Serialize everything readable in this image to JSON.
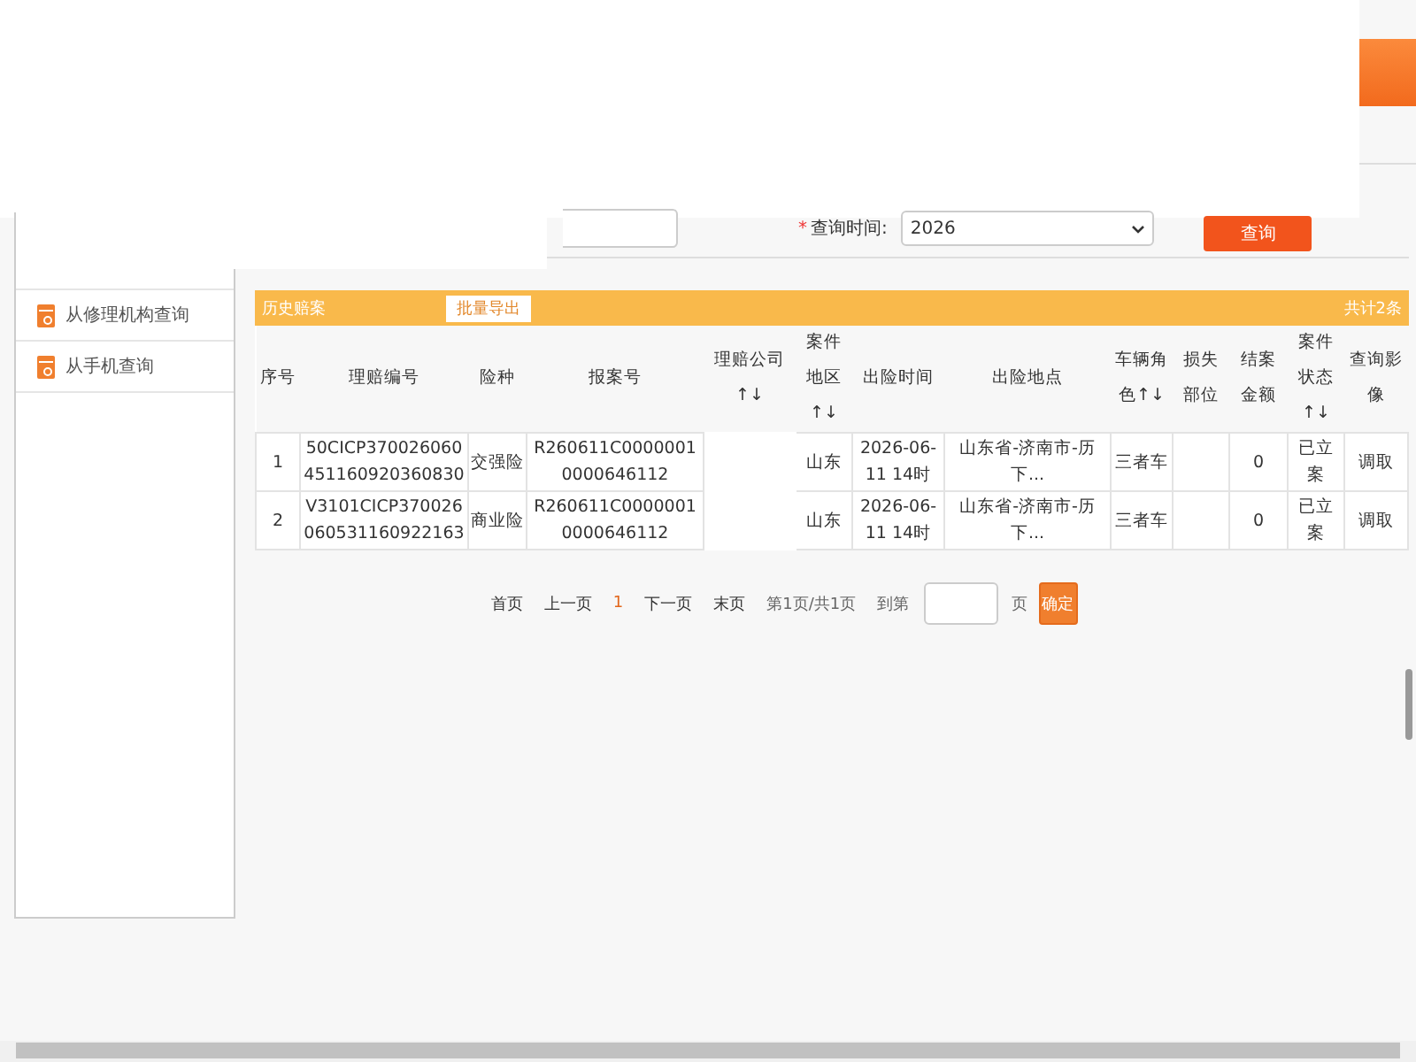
{
  "query": {
    "label": "查询时间:",
    "required_mark": "*",
    "year": "2026",
    "button": "查询"
  },
  "sidebar": {
    "items": [
      {
        "label": "从修理机构查询"
      },
      {
        "label": "从手机查询"
      }
    ]
  },
  "claims": {
    "title": "历史赔案",
    "export_button": "批量导出",
    "total": "共计2条",
    "columns": [
      "序号",
      "理赔编号",
      "险种",
      "报案号",
      "理赔公司↑↓",
      "案件地区↑↓",
      "出险时间",
      "出险地点",
      "车辆角色↑↓",
      "损失部位",
      "结案金额",
      "案件状态↑↓",
      "查询影像"
    ],
    "rows": [
      {
        "no": "1",
        "claim_no": "50CICP370026060451160920360830",
        "insurance": "交强险",
        "report_no": "R260611C00000010000646112",
        "region": "山东",
        "time": "2026-06-11 14时",
        "place": "山东省-济南市-历下...",
        "role": "三者车",
        "amount": "0",
        "status": "已立案",
        "action": "调取"
      },
      {
        "no": "2",
        "claim_no": "V3101CICP370026060531160922163",
        "insurance": "商业险",
        "report_no": "R260611C00000010000646112",
        "region": "山东",
        "time": "2026-06-11 14时",
        "place": "山东省-济南市-历下...",
        "role": "三者车",
        "amount": "0",
        "status": "已立案",
        "action": "调取"
      }
    ]
  },
  "pager": {
    "first": "首页",
    "prev": "上一页",
    "current": "1",
    "next": "下一页",
    "last": "末页",
    "info": "第1页/共1页",
    "goto": "到第",
    "page_unit": "页",
    "confirm": "确定"
  }
}
